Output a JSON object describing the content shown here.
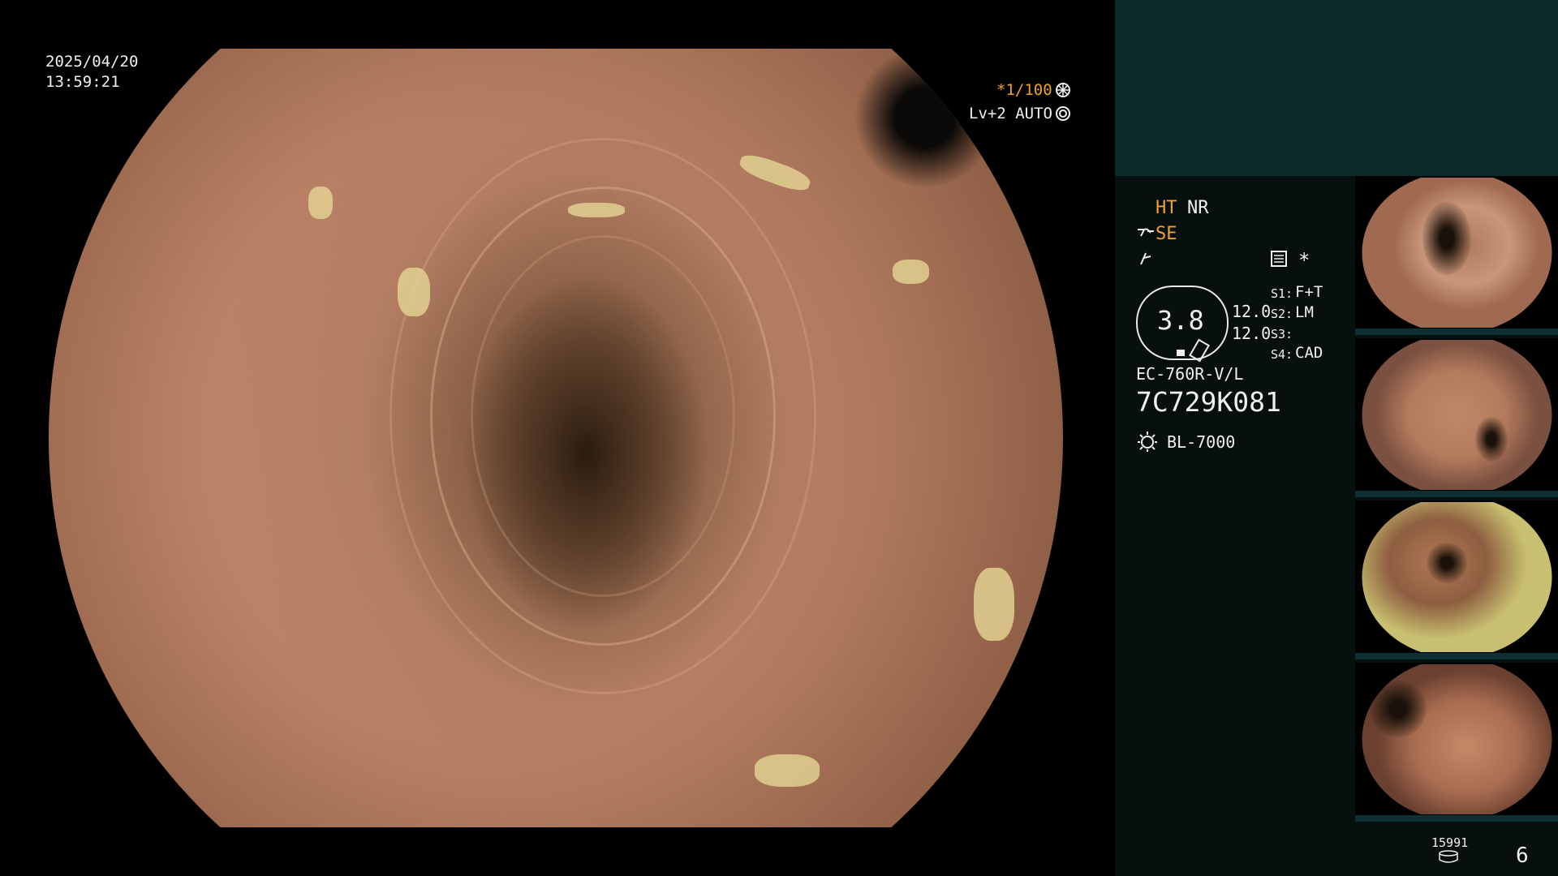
{
  "overlay": {
    "date": "2025/04/20",
    "time": "13:59:21",
    "shutter": "*1/100",
    "level_mode": "Lv+2  AUTO"
  },
  "settings": {
    "ht": "HT",
    "nr": "NR",
    "se": "SE",
    "zoom": "3.8",
    "value_top": "12.0",
    "value_bottom": "12.0",
    "s1_label": "S1:",
    "s1_value": "F+T",
    "s2_label": "S2:",
    "s2_value": "LM",
    "s3_label": "S3:",
    "s3_value": "",
    "s4_label": "S4:",
    "s4_value": "CAD",
    "asterisk": "*"
  },
  "scope": {
    "model": "EC-760R-V/L",
    "serial": "7C729K081",
    "light_source": "BL-7000"
  },
  "footer": {
    "counter": "15991",
    "page": "6"
  },
  "colors": {
    "accent_orange": "#f0a030",
    "panel_teal": "#0d2a2a",
    "panel_dark": "#070f0f"
  },
  "icons": [
    "shutter-icon",
    "iris-icon",
    "se-icon",
    "lightning-icon",
    "menu-icon",
    "light-source-icon",
    "storage-icon"
  ]
}
